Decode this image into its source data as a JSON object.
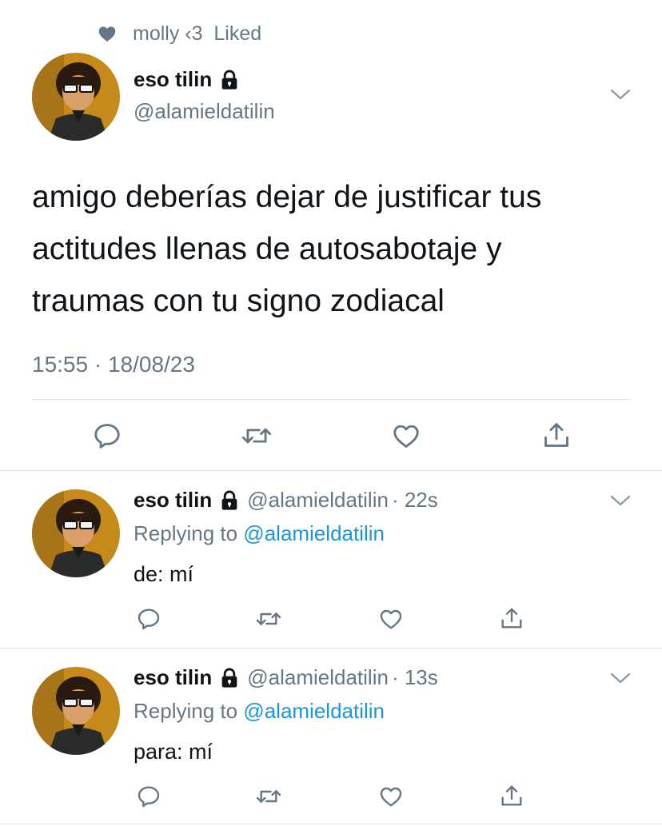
{
  "social_context": {
    "text": "molly ‹3  Liked"
  },
  "main_tweet": {
    "display_name": "eso tilin",
    "handle": "@alamieldatilin",
    "body_lines": [
      "amigo deberías dejar de justificar tus",
      "actitudes llenas de autosabotaje y",
      "traumas con tu signo zodiacal"
    ],
    "timestamp": "15:55 · 18/08/23"
  },
  "replies": [
    {
      "display_name": "eso tilin",
      "handle": "@alamieldatilin",
      "time": "· 22s",
      "replying_prefix": "Replying to",
      "replying_to": "@alamieldatilin",
      "text": "de: mí"
    },
    {
      "display_name": "eso tilin",
      "handle": "@alamieldatilin",
      "time": "· 13s",
      "replying_prefix": "Replying to",
      "replying_to": "@alamieldatilin",
      "text": "para: mí"
    }
  ],
  "icons": {
    "liked": "heart-filled-icon",
    "lock": "lock-icon",
    "more": "chevron-down-icon",
    "reply": "reply-icon",
    "retweet": "retweet-icon",
    "like": "heart-icon",
    "share": "share-icon"
  },
  "colors": {
    "link": "#1b95e0",
    "secondary": "#657786",
    "text": "#0f1419"
  }
}
